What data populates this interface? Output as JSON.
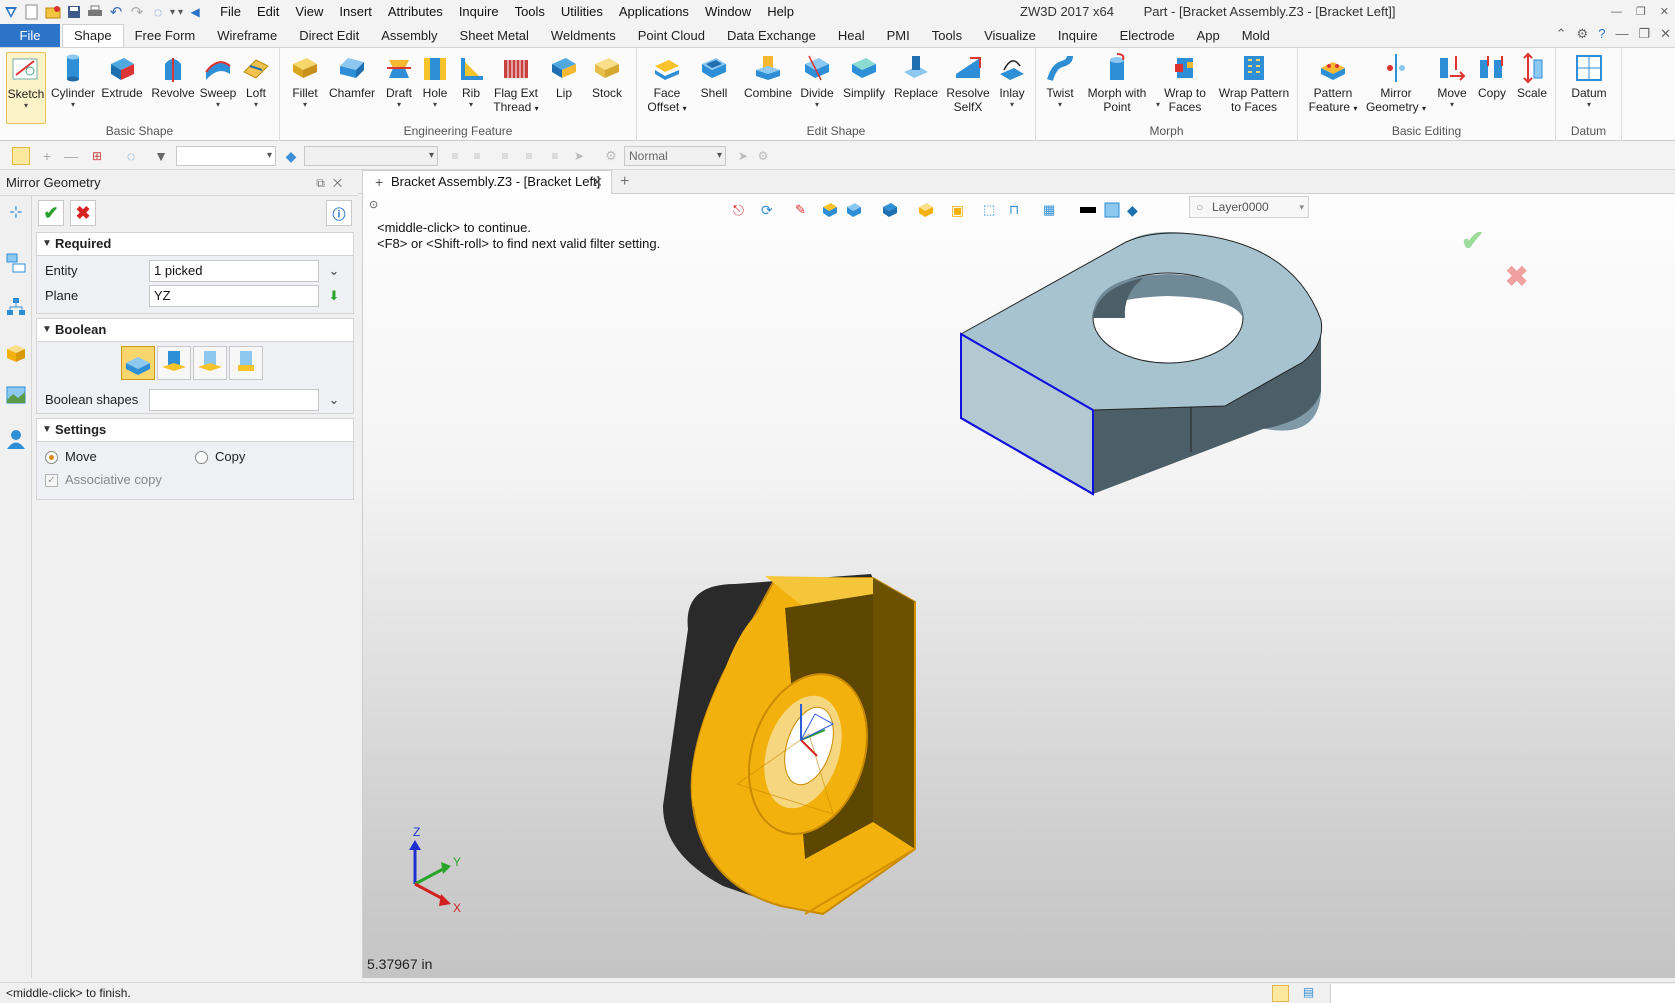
{
  "window": {
    "app": "ZW3D 2017  x64",
    "doc_title": "Part - [Bracket Assembly.Z3 - [Bracket Left]]"
  },
  "menu": [
    "File",
    "Edit",
    "View",
    "Insert",
    "Attributes",
    "Inquire",
    "Tools",
    "Utilities",
    "Applications",
    "Window",
    "Help"
  ],
  "ribbon_tabs": [
    "File",
    "Shape",
    "Free Form",
    "Wireframe",
    "Direct Edit",
    "Assembly",
    "Sheet Metal",
    "Weldments",
    "Point Cloud",
    "Data Exchange",
    "Heal",
    "PMI",
    "Tools",
    "Visualize",
    "Inquire",
    "Electrode",
    "App",
    "Mold"
  ],
  "active_tab": "Shape",
  "ribbon": {
    "basic_shape": {
      "label": "Basic Shape",
      "buttons": [
        "Sketch",
        "Cylinder",
        "Extrude",
        "Revolve",
        "Sweep",
        "Loft"
      ]
    },
    "engineering_feature": {
      "label": "Engineering Feature",
      "buttons": [
        "Fillet",
        "Chamfer",
        "Draft",
        "Hole",
        "Rib",
        "Flag Ext",
        "Thread",
        "Lip",
        "Stock"
      ]
    },
    "edit_shape": {
      "label": "Edit Shape",
      "buttons": [
        "Face",
        "Offset",
        "Shell",
        "Combine",
        "Divide",
        "Simplify",
        "Replace",
        "Resolve",
        "SelfX",
        "Inlay"
      ]
    },
    "morph": {
      "label": "Morph",
      "buttons": [
        "Twist",
        "Morph with",
        "Point",
        "Wrap to",
        "Faces",
        "Wrap Pattern",
        "to Faces"
      ]
    },
    "basic_editing": {
      "label": "Basic Editing",
      "buttons": [
        "Pattern",
        "Feature",
        "Mirror",
        "Geometry",
        "Move",
        "Copy",
        "Scale"
      ]
    },
    "datum": {
      "label": "Datum",
      "buttons": [
        "Datum"
      ]
    }
  },
  "toolbar2": {
    "render_mode": "Normal"
  },
  "panel": {
    "title": "Mirror Geometry",
    "required": {
      "label": "Required",
      "entity_label": "Entity",
      "entity_value": "1 picked",
      "plane_label": "Plane",
      "plane_value": "YZ"
    },
    "boolean": {
      "label": "Boolean",
      "shapes_label": "Boolean shapes",
      "shapes_value": ""
    },
    "settings": {
      "label": "Settings",
      "move_label": "Move",
      "copy_label": "Copy",
      "associative_label": "Associative copy",
      "mode": "Move",
      "associative_checked": true
    }
  },
  "doc_tab": "Bracket Assembly.Z3 - [Bracket Left]",
  "viewport": {
    "prompt_line1": "<middle-click> to continue.",
    "prompt_line2": "<F8> or <Shift-roll> to find next valid filter setting.",
    "layer": "Layer0000",
    "distance": "5.37967 in",
    "triad_labels": {
      "x": "X",
      "y": "Y",
      "z": "Z"
    }
  },
  "status": {
    "message": "<middle-click> to finish."
  },
  "colors": {
    "accent": "#2b74c7",
    "selected_part": "#f2b10c",
    "mirror_part": "#a6c3cf",
    "edge_highlight": "#1010e0"
  }
}
